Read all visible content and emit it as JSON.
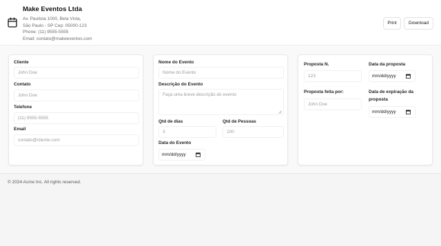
{
  "header": {
    "company_name": "Make Eventos Ltda",
    "address_line1": "Av. Paulista 1000, Bela Vista,",
    "address_line2": "São Paulo - SP Cep: 05000-123",
    "phone": "Phone: (11) 9555-5555",
    "email": "Email: contato@makeeventos.com",
    "print_label": "Print",
    "download_label": "Download",
    "icon": "calendar-icon"
  },
  "client_card": {
    "client_label": "Cliente",
    "client_placeholder": "John Doe",
    "contact_label": "Contato",
    "contact_placeholder": "John Doe",
    "phone_label": "Telefone",
    "phone_placeholder": "(11) 9555-5555",
    "email_label": "Email",
    "email_placeholder": "contato@cliente.com"
  },
  "event_card": {
    "name_label": "Nome do Evento",
    "name_placeholder": "Nome do Evento",
    "desc_label": "Descrição do Evento",
    "desc_placeholder": "Faça uma breve descrição do evento",
    "days_label": "Qtd de dias",
    "days_placeholder": "3",
    "people_label": "Qtd de Pessoas",
    "people_placeholder": "100",
    "date_label": "Data do Evento",
    "date_value": "mm/dd/yyyy"
  },
  "proposal_card": {
    "number_label": "Proposta N.",
    "number_placeholder": "123",
    "date_label": "Data da proposta",
    "date_value": "mm/dd/yyyy",
    "made_by_label": "Proposta feita por:",
    "made_by_placeholder": "John Doe",
    "expiry_label_line1": "Data de expiração da",
    "expiry_label_line2": "proposta",
    "expiry_value": "mm/dd/yyyy"
  },
  "footer": {
    "copyright": "© 2024 Acme Inc. All rights reserved."
  }
}
